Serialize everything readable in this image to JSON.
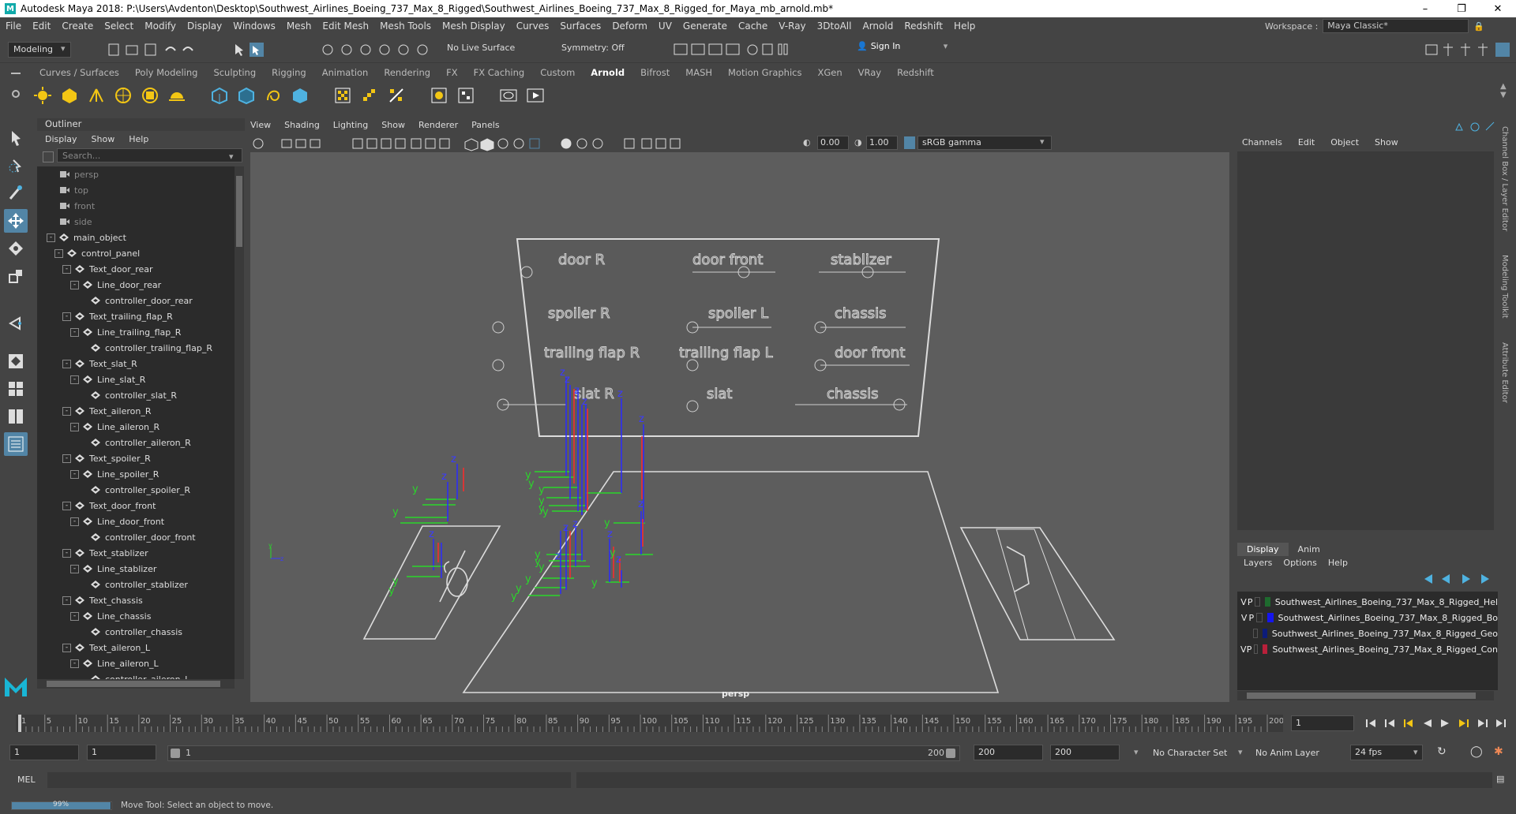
{
  "window": {
    "title": "Autodesk Maya 2018: P:\\Users\\Avdenton\\Desktop\\Southwest_Airlines_Boeing_737_Max_8_Rigged\\Southwest_Airlines_Boeing_737_Max_8_Rigged_for_Maya_mb_arnold.mb*"
  },
  "menubar": {
    "items": [
      "File",
      "Edit",
      "Create",
      "Select",
      "Modify",
      "Display",
      "Windows",
      "Mesh",
      "Edit Mesh",
      "Mesh Tools",
      "Mesh Display",
      "Curves",
      "Surfaces",
      "Deform",
      "UV",
      "Generate",
      "Cache",
      "V-Ray",
      "3DtoAll",
      "Arnold",
      "Redshift",
      "Help"
    ],
    "workspace_label": "Workspace :",
    "workspace_value": "Maya Classic*"
  },
  "statusline": {
    "mode": "Modeling",
    "live_surface": "No Live Surface",
    "symmetry": "Symmetry: Off",
    "sign_in": "Sign In"
  },
  "shelf": {
    "tabs": [
      "Curves / Surfaces",
      "Poly Modeling",
      "Sculpting",
      "Rigging",
      "Animation",
      "Rendering",
      "FX",
      "FX Caching",
      "Custom",
      "Arnold",
      "Bifrost",
      "MASH",
      "Motion Graphics",
      "XGen",
      "VRay",
      "Redshift"
    ],
    "active_tab": "Arnold"
  },
  "outliner": {
    "title": "Outliner",
    "menu": [
      "Display",
      "Show",
      "Help"
    ],
    "search_placeholder": "Search...",
    "rows": [
      {
        "label": "persp",
        "indent": 0,
        "kind": "camera",
        "dim": true
      },
      {
        "label": "top",
        "indent": 0,
        "kind": "camera",
        "dim": true
      },
      {
        "label": "front",
        "indent": 0,
        "kind": "camera",
        "dim": true
      },
      {
        "label": "side",
        "indent": 0,
        "kind": "camera",
        "dim": true
      },
      {
        "label": "main_object",
        "indent": 0,
        "kind": "group",
        "exp": "-"
      },
      {
        "label": "control_panel",
        "indent": 1,
        "kind": "group",
        "exp": "-"
      },
      {
        "label": "Text_door_rear",
        "indent": 2,
        "kind": "group",
        "exp": "-"
      },
      {
        "label": "Line_door_rear",
        "indent": 3,
        "kind": "group",
        "exp": "-"
      },
      {
        "label": "controller_door_rear",
        "indent": 4,
        "kind": "group"
      },
      {
        "label": "Text_trailing_flap_R",
        "indent": 2,
        "kind": "group",
        "exp": "-"
      },
      {
        "label": "Line_trailing_flap_R",
        "indent": 3,
        "kind": "group",
        "exp": "-"
      },
      {
        "label": "controller_trailing_flap_R",
        "indent": 4,
        "kind": "group"
      },
      {
        "label": "Text_slat_R",
        "indent": 2,
        "kind": "group",
        "exp": "-"
      },
      {
        "label": "Line_slat_R",
        "indent": 3,
        "kind": "group",
        "exp": "-"
      },
      {
        "label": "controller_slat_R",
        "indent": 4,
        "kind": "group"
      },
      {
        "label": "Text_aileron_R",
        "indent": 2,
        "kind": "group",
        "exp": "-"
      },
      {
        "label": "Line_aileron_R",
        "indent": 3,
        "kind": "group",
        "exp": "-"
      },
      {
        "label": "controller_aileron_R",
        "indent": 4,
        "kind": "group"
      },
      {
        "label": "Text_spoiler_R",
        "indent": 2,
        "kind": "group",
        "exp": "-"
      },
      {
        "label": "Line_spoiler_R",
        "indent": 3,
        "kind": "group",
        "exp": "-"
      },
      {
        "label": "controller_spoiler_R",
        "indent": 4,
        "kind": "group"
      },
      {
        "label": "Text_door_front",
        "indent": 2,
        "kind": "group",
        "exp": "-"
      },
      {
        "label": "Line_door_front",
        "indent": 3,
        "kind": "group",
        "exp": "-"
      },
      {
        "label": "controller_door_front",
        "indent": 4,
        "kind": "group"
      },
      {
        "label": "Text_stablizer",
        "indent": 2,
        "kind": "group",
        "exp": "-"
      },
      {
        "label": "Line_stablizer",
        "indent": 3,
        "kind": "group",
        "exp": "-"
      },
      {
        "label": "controller_stablizer",
        "indent": 4,
        "kind": "group"
      },
      {
        "label": "Text_chassis",
        "indent": 2,
        "kind": "group",
        "exp": "-"
      },
      {
        "label": "Line_chassis",
        "indent": 3,
        "kind": "group",
        "exp": "-"
      },
      {
        "label": "controller_chassis",
        "indent": 4,
        "kind": "group"
      },
      {
        "label": "Text_aileron_L",
        "indent": 2,
        "kind": "group",
        "exp": "-"
      },
      {
        "label": "Line_aileron_L",
        "indent": 3,
        "kind": "group",
        "exp": "-"
      },
      {
        "label": "controller_aileron_L",
        "indent": 4,
        "kind": "group"
      }
    ]
  },
  "viewport": {
    "menu": [
      "View",
      "Shading",
      "Lighting",
      "Show",
      "Renderer",
      "Panels"
    ],
    "exposure": "0.00",
    "gamma": "1.00",
    "color_space": "sRGB gamma",
    "camera_label": "persp"
  },
  "channelbox": {
    "menu": [
      "Channels",
      "Edit",
      "Object",
      "Show"
    ],
    "side_tabs": [
      "Channel Box / Layer Editor",
      "Modeling Toolkit",
      "Attribute Editor"
    ]
  },
  "layers": {
    "tabs": [
      "Display",
      "Anim"
    ],
    "active_tab": "Display",
    "menu": [
      "Layers",
      "Options",
      "Help"
    ],
    "rows": [
      {
        "v": "V",
        "p": "P",
        "color": "#1e6a2e",
        "name": "Southwest_Airlines_Boeing_737_Max_8_Rigged_Hel"
      },
      {
        "v": "V",
        "p": "P",
        "color": "#1515ee",
        "name": "Southwest_Airlines_Boeing_737_Max_8_Rigged_Bo"
      },
      {
        "v": "",
        "p": "",
        "color": "#0c1c7a",
        "name": "Southwest_Airlines_Boeing_737_Max_8_Rigged_Geo"
      },
      {
        "v": "V",
        "p": "P",
        "color": "#b8203a",
        "name": "Southwest_Airlines_Boeing_737_Max_8_Rigged_Con"
      }
    ]
  },
  "timeline": {
    "ticks": [
      "1",
      "5",
      "10",
      "15",
      "20",
      "25",
      "30",
      "35",
      "40",
      "45",
      "50",
      "55",
      "60",
      "65",
      "70",
      "75",
      "80",
      "85",
      "90",
      "95",
      "100",
      "105",
      "110",
      "115",
      "120",
      "125",
      "130",
      "135",
      "140",
      "145",
      "150",
      "155",
      "160",
      "165",
      "170",
      "175",
      "180",
      "185",
      "190",
      "195",
      "200"
    ],
    "current_frame": "1",
    "range_start": "1",
    "range_inner_start": "1",
    "range_slider_start": "1",
    "range_slider_end": "200",
    "range_end": "200",
    "range_outer_end": "200",
    "character_set": "No Character Set",
    "anim_layer": "No Anim Layer",
    "fps": "24 fps"
  },
  "cmdline": {
    "label": "MEL"
  },
  "helpline": {
    "progress": "99%",
    "message": "Move Tool: Select an object to move."
  }
}
